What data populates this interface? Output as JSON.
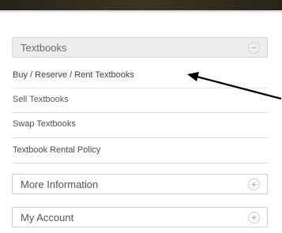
{
  "menu": {
    "textbooks": {
      "label": "Textbooks",
      "toggle_icon": "minus-circle-icon",
      "expanded": true,
      "items": [
        {
          "label": "Buy / Reserve / Rent Textbooks"
        },
        {
          "label": "Sell Textbooks"
        },
        {
          "label": "Swap Textbooks"
        },
        {
          "label": "Textbook Rental Policy"
        }
      ]
    },
    "more_information": {
      "label": "More Information",
      "toggle_icon": "plus-circle-icon",
      "expanded": false
    },
    "my_account": {
      "label": "My Account",
      "toggle_icon": "plus-circle-icon",
      "expanded": false
    }
  },
  "annotation": {
    "icon": "arrow-icon",
    "color": "#000000"
  },
  "colors": {
    "top_bar": "#2e2719",
    "active_header_bg": "#ececec",
    "border": "#cfcfcf",
    "link_text": "#434343"
  }
}
